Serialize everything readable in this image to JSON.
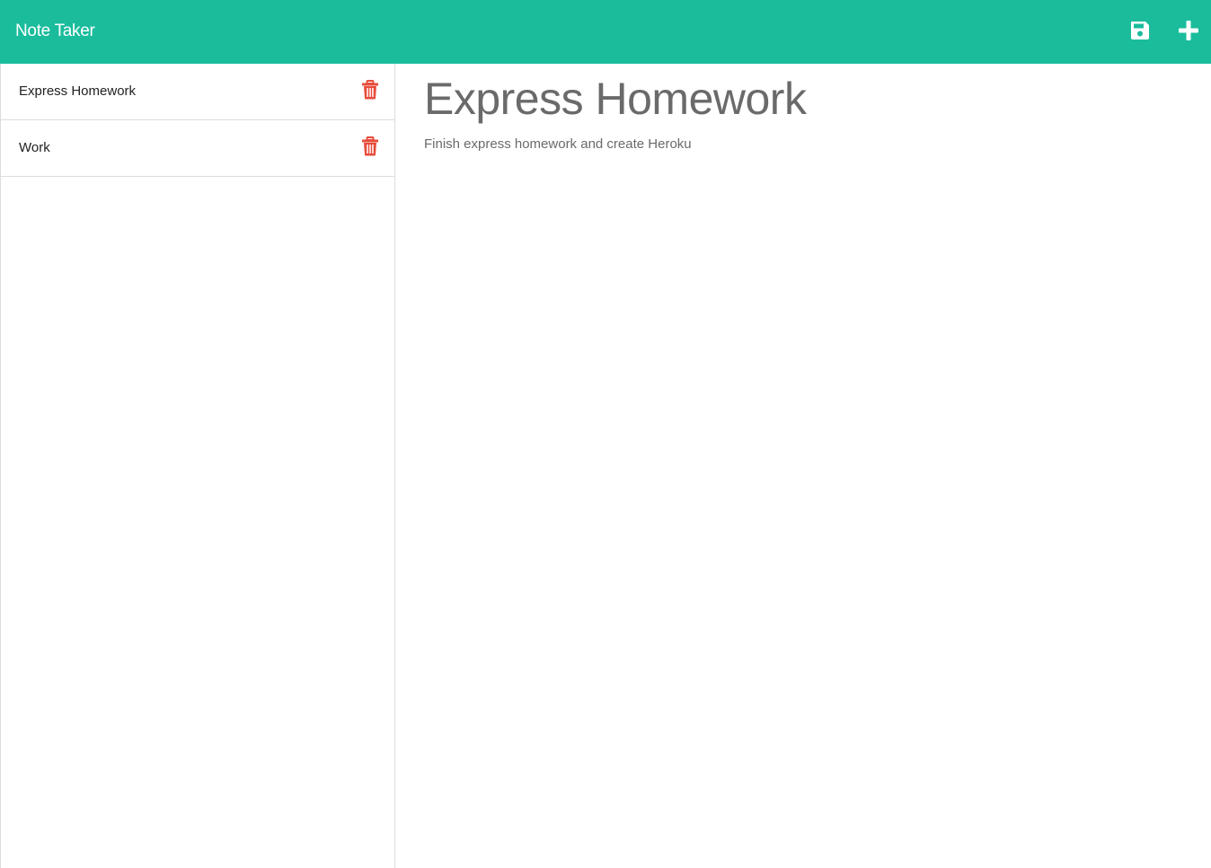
{
  "app": {
    "title": "Note Taker"
  },
  "header": {
    "save_icon": "save-icon",
    "new_icon": "plus-icon"
  },
  "sidebar": {
    "notes": [
      {
        "title": "Express Homework",
        "delete_icon": "trash-icon"
      },
      {
        "title": "Work",
        "delete_icon": "trash-icon"
      }
    ]
  },
  "editor": {
    "title": "Express Homework",
    "text": "Finish express homework and create Heroku"
  },
  "colors": {
    "accent": "#1abc9c",
    "danger": "#e74c3c",
    "text_muted": "#6a6a6a"
  }
}
